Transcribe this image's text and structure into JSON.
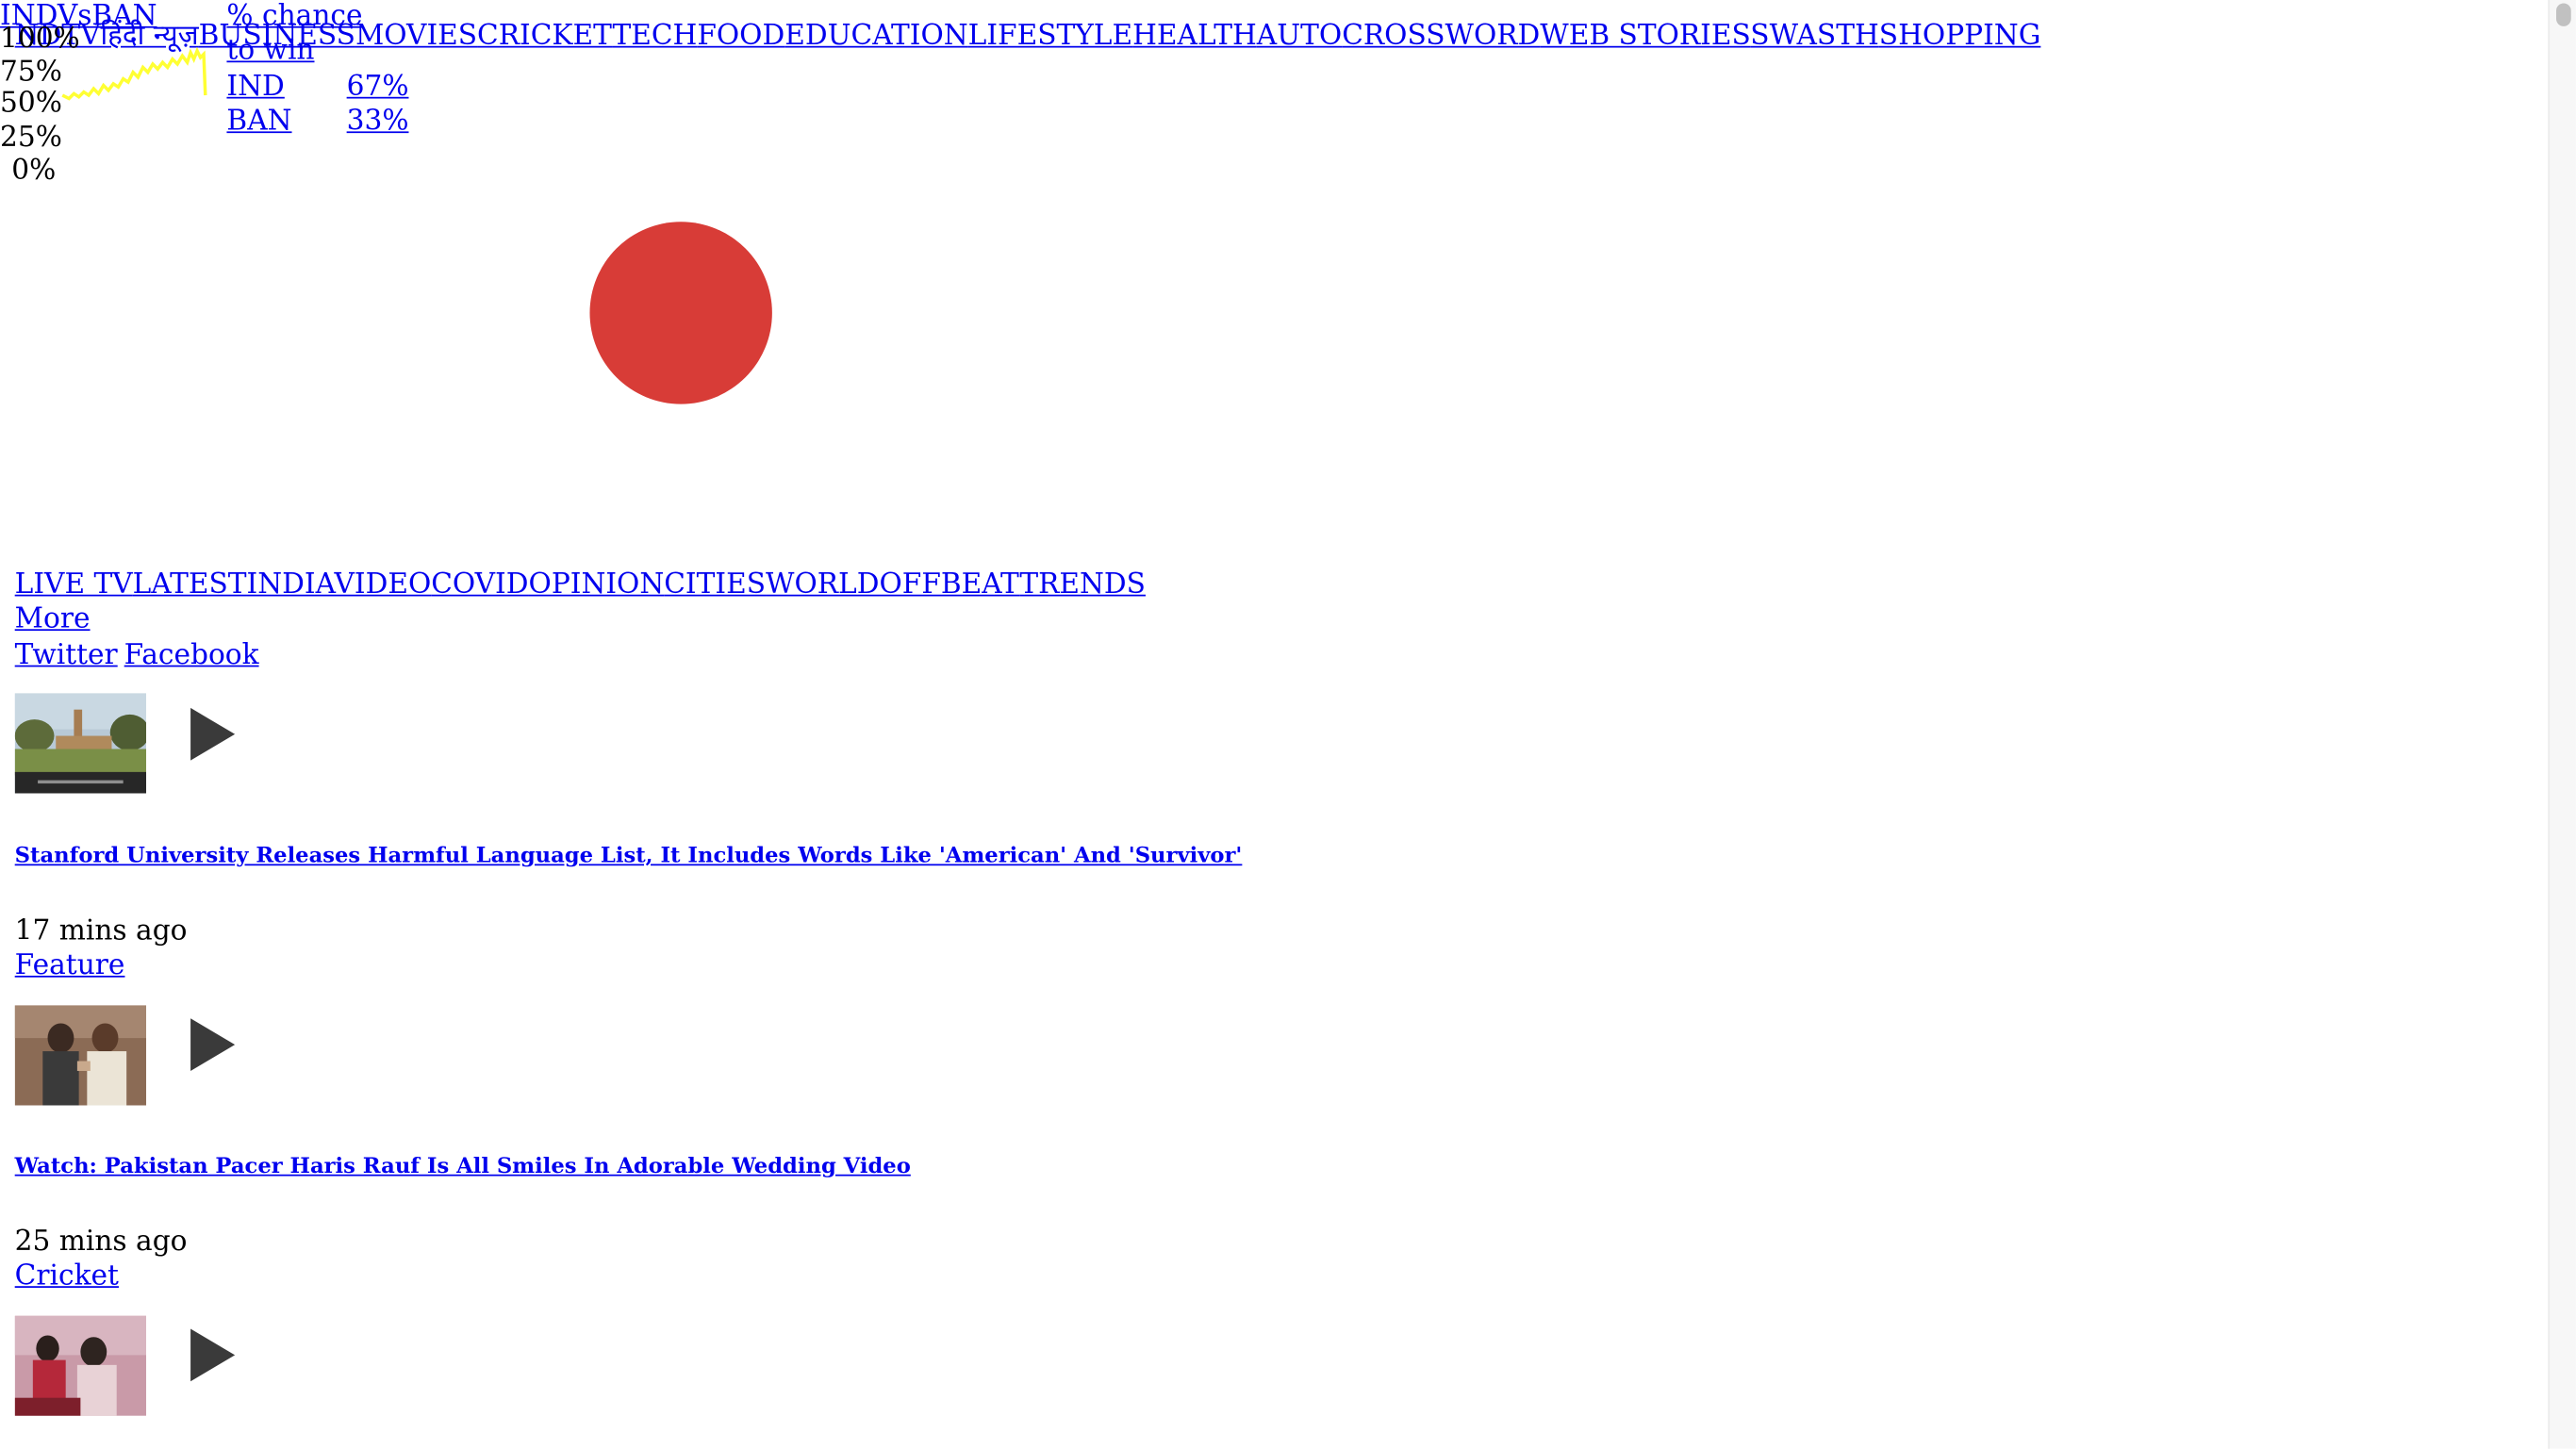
{
  "ticker": {
    "match_title": "INDVsBAN",
    "chance_label_line1": "% chance",
    "chance_label_line2": "to win",
    "y_ticks": [
      "100%",
      "75%",
      "50%",
      "25%",
      "0%"
    ],
    "teams": [
      {
        "name": "IND",
        "pct": "67%"
      },
      {
        "name": "BAN",
        "pct": "33%"
      }
    ],
    "line_color": "#ffff33"
  },
  "top_nav": {
    "items": [
      "NDTV",
      "हिंदी न्यूज़",
      "BUSINESS",
      "MOVIES",
      "CRICKET",
      "TECH",
      "FOOD",
      "EDUCATION",
      "LIFESTYLE",
      "HEALTH",
      "AUTO",
      "CROSSWORD",
      "WEB STORIES",
      "SWASTH",
      "SHOPPING"
    ]
  },
  "promo": {
    "circle_color": "#d83c37"
  },
  "section_nav": {
    "items": [
      "LIVE TV",
      "LATEST",
      "INDIA",
      "VIDEO",
      "COVID",
      "OPINION",
      "CITIES",
      "WORLD",
      "OFFBEAT",
      "TRENDS"
    ],
    "more": "More"
  },
  "social": {
    "twitter": "Twitter",
    "facebook": "Facebook"
  },
  "stories": [
    {
      "headline": "Stanford University Releases Harmful Language List, It Includes Words Like 'American' And 'Survivor'",
      "time": "17 mins ago",
      "category": "Feature"
    },
    {
      "headline": "Watch: Pakistan Pacer Haris Rauf Is All Smiles In Adorable Wedding Video",
      "time": "25 mins ago",
      "category": "Cricket"
    },
    {
      "headline": "",
      "time": "",
      "category": ""
    }
  ]
}
